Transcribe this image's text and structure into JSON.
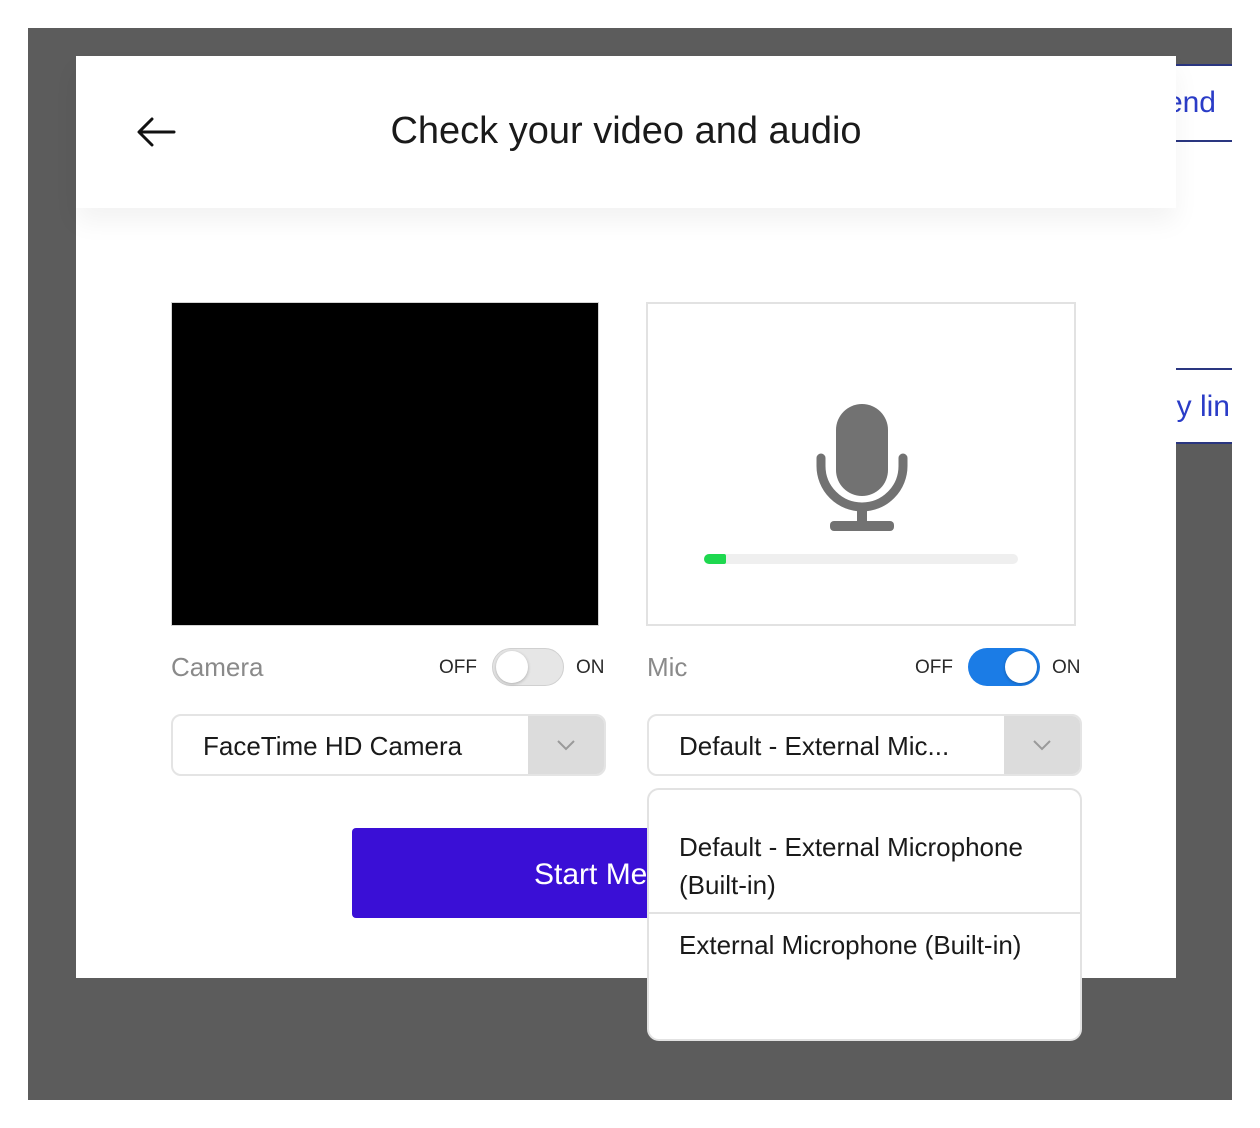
{
  "background": {
    "partial_link_1": "end",
    "partial_link_2": "y lin"
  },
  "modal": {
    "title": "Check your video and audio"
  },
  "camera": {
    "label": "Camera",
    "toggle_off_label": "OFF",
    "toggle_on_label": "ON",
    "enabled": false,
    "selected_device": "FaceTime HD Camera"
  },
  "mic": {
    "label": "Mic",
    "toggle_off_label": "OFF",
    "toggle_on_label": "ON",
    "enabled": true,
    "selected_device": "Default - External Mic...",
    "level": 0.07,
    "level_color": "#1ed84f",
    "options": [
      "Default - External Microphone (Built-in)",
      "External Microphone (Built-in)"
    ]
  },
  "start_button": {
    "label": "Start Me"
  },
  "colors": {
    "accent": "#3a0fd6",
    "toggle_on": "#1b7ce6",
    "link": "#2a3cc7"
  }
}
